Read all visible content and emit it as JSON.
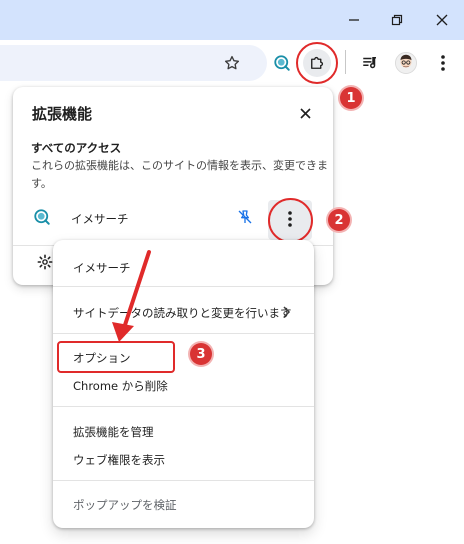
{
  "panel": {
    "title": "拡張機能",
    "access_title": "すべてのアクセス",
    "access_desc": "これらの拡張機能は、このサイトの情報を表示、変更できます。",
    "extension_name": "イメサーチ"
  },
  "menu": {
    "items": [
      "イメサーチ",
      "サイトデータの読み取りと変更を行います",
      "オプション",
      "Chrome から削除",
      "拡張機能を管理",
      "ウェブ権限を表示",
      "ポップアップを検証"
    ]
  },
  "annotations": {
    "badge_1": "1",
    "badge_2": "2",
    "badge_3": "3"
  },
  "colors": {
    "titlebar": "#d3e3fd",
    "annotation_red": "#e02a2a",
    "extension_icon": "#1a8fa8"
  },
  "icons": [
    "minimize-icon",
    "restore-icon",
    "close-icon",
    "star-icon",
    "extension-image-search-icon",
    "puzzle-icon",
    "media-controls-icon",
    "avatar",
    "kebab-menu-icon",
    "pin-off-icon",
    "gear-icon",
    "chevron-right-icon"
  ]
}
